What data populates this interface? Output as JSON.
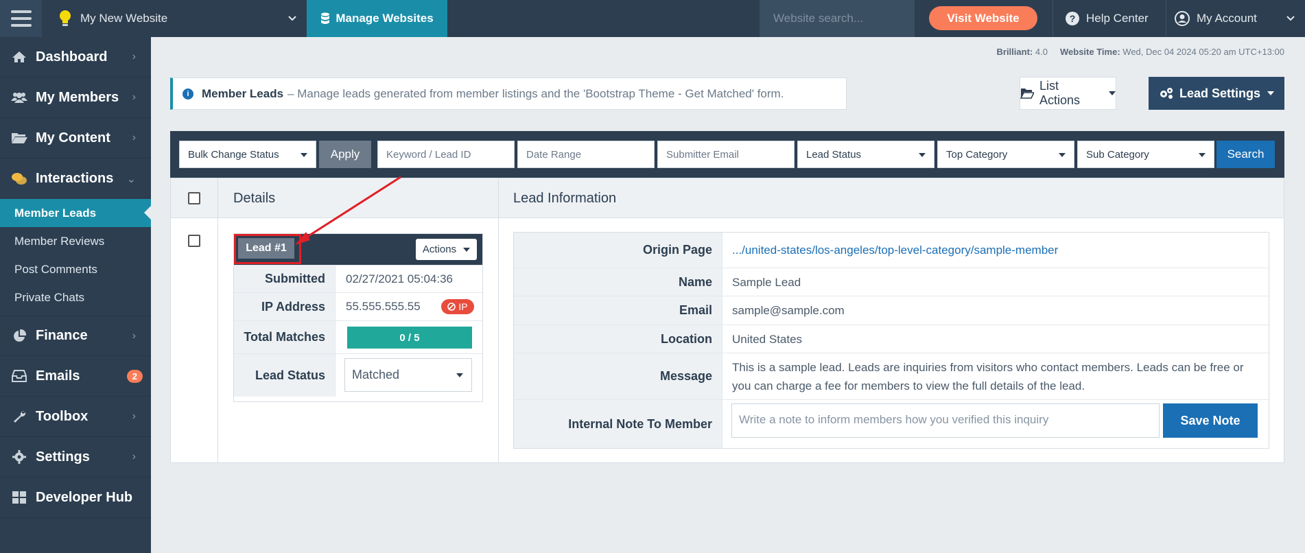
{
  "topbar": {
    "site_name": "My New Website",
    "manage_label": "Manage Websites",
    "search_placeholder": "Website search...",
    "visit_label": "Visit Website",
    "help_label": "Help Center",
    "account_label": "My Account"
  },
  "sidebar": {
    "items": [
      {
        "label": "Dashboard",
        "icon": "home-icon"
      },
      {
        "label": "My Members",
        "icon": "users-icon"
      },
      {
        "label": "My Content",
        "icon": "folder-icon"
      },
      {
        "label": "Interactions",
        "icon": "comments-icon"
      },
      {
        "label": "Finance",
        "icon": "pie-chart-icon"
      },
      {
        "label": "Emails",
        "icon": "inbox-icon",
        "badge": "2"
      },
      {
        "label": "Toolbox",
        "icon": "wrench-icon"
      },
      {
        "label": "Settings",
        "icon": "gear-icon"
      },
      {
        "label": "Developer Hub",
        "icon": "grid-icon"
      }
    ],
    "sub_items": [
      "Member Leads",
      "Member Reviews",
      "Post Comments",
      "Private Chats"
    ]
  },
  "meta": {
    "brilliant_label": "Brilliant:",
    "brilliant_value": "4.0",
    "time_label": "Website Time:",
    "time_value": "Wed, Dec 04 2024 05:20 am UTC+13:00"
  },
  "header": {
    "title": "Member Leads",
    "description": "– Manage leads generated from member listings and the 'Bootstrap Theme - Get Matched' form.",
    "list_actions_label": "List Actions",
    "lead_settings_label": "Lead Settings"
  },
  "filters": {
    "bulk_label": "Bulk Change Status",
    "apply_label": "Apply",
    "keyword_placeholder": "Keyword / Lead ID",
    "date_placeholder": "Date Range",
    "email_placeholder": "Submitter Email",
    "status_label": "Lead Status",
    "top_category_label": "Top Category",
    "sub_category_label": "Sub Category",
    "search_label": "Search"
  },
  "table": {
    "col_details": "Details",
    "col_info": "Lead Information"
  },
  "lead": {
    "tag": "Lead #1",
    "actions_label": "Actions",
    "submitted_label": "Submitted",
    "submitted_value": "02/27/2021 05:04:36",
    "ip_label": "IP Address",
    "ip_value": "55.555.555.55",
    "ip_badge": "IP",
    "matches_label": "Total Matches",
    "matches_value": "0 / 5",
    "status_label": "Lead Status",
    "status_value": "Matched"
  },
  "info": {
    "origin_label": "Origin Page",
    "origin_value": ".../united-states/los-angeles/top-level-category/sample-member",
    "name_label": "Name",
    "name_value": "Sample Lead",
    "email_label": "Email",
    "email_value": "sample@sample.com",
    "location_label": "Location",
    "location_value": "United States",
    "message_label": "Message",
    "message_value": "This is a sample lead. Leads are inquiries from visitors who contact members. Leads can be free or you can charge a fee for members to view the full details of the lead.",
    "note_label": "Internal Note To Member",
    "note_placeholder": "Write a note to inform members how you verified this inquiry",
    "save_label": "Save Note"
  },
  "colors": {
    "navy": "#2c3e50",
    "teal": "#1a8ea8",
    "orange": "#fa7d5a",
    "blue": "#1a6fb5",
    "green": "#20a89a",
    "red": "#e01f26"
  }
}
